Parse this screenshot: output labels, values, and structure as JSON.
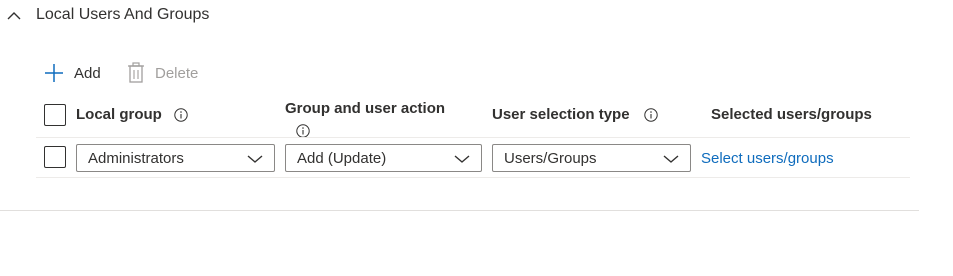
{
  "section": {
    "title": "Local Users And Groups"
  },
  "toolbar": {
    "add_label": "Add",
    "delete_label": "Delete"
  },
  "table": {
    "headers": {
      "local_group": "Local group",
      "group_user_action": "Group and user action",
      "user_selection_type": "User selection type",
      "selected_users_groups": "Selected users/groups"
    },
    "rows": [
      {
        "local_group": "Administrators",
        "action": "Add (Update)",
        "selection_type": "Users/Groups",
        "select_link": "Select users/groups"
      }
    ]
  },
  "colors": {
    "link": "#0f6cbd",
    "text": "#323130",
    "disabled": "#a19f9d",
    "border": "#8a8886"
  },
  "icons": [
    "chevron-up-icon",
    "plus-icon",
    "trash-icon",
    "info-icon",
    "chevron-down-icon"
  ]
}
